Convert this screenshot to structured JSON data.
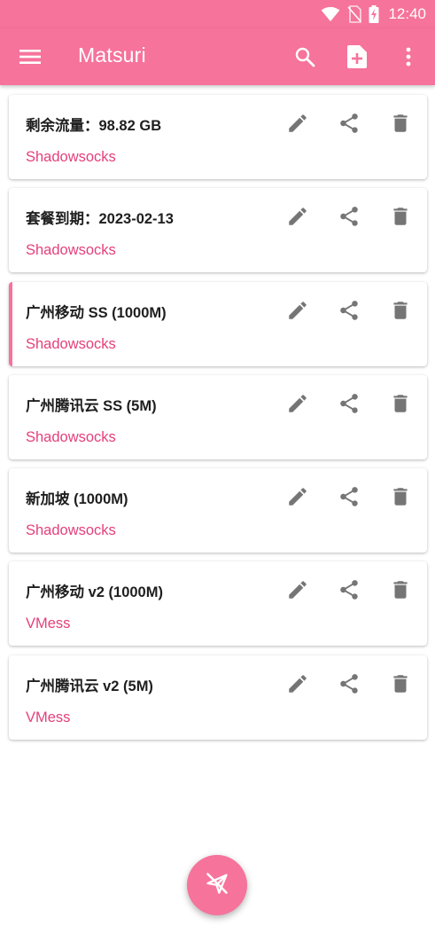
{
  "status_bar": {
    "time": "12:40",
    "icons": [
      "wifi-icon",
      "no-sim-icon",
      "battery-charging-icon"
    ]
  },
  "app_bar": {
    "title": "Matsuri",
    "background_color": "#f6739b",
    "actions": [
      "search-icon",
      "new-file-icon",
      "more-vert-icon"
    ]
  },
  "profiles": [
    {
      "name": "剩余流量：98.82 GB",
      "type": "Shadowsocks",
      "selected": false
    },
    {
      "name": "套餐到期：2023-02-13",
      "type": "Shadowsocks",
      "selected": false
    },
    {
      "name": "广州移动 SS (1000M)",
      "type": "Shadowsocks",
      "selected": true
    },
    {
      "name": "广州腾讯云 SS (5M)",
      "type": "Shadowsocks",
      "selected": false
    },
    {
      "name": "新加坡 (1000M)",
      "type": "Shadowsocks",
      "selected": false
    },
    {
      "name": "广州移动 v2 (1000M)",
      "type": "VMess",
      "selected": false
    },
    {
      "name": "广州腾讯云 v2 (5M)",
      "type": "VMess",
      "selected": false
    }
  ],
  "row_actions": [
    "edit-icon",
    "share-icon",
    "delete-icon"
  ],
  "fab": {
    "icon": "paper-plane-off-icon"
  },
  "colors": {
    "accent": "#f6739b",
    "type_text": "#e53f7a",
    "icon_gray": "#757575"
  }
}
